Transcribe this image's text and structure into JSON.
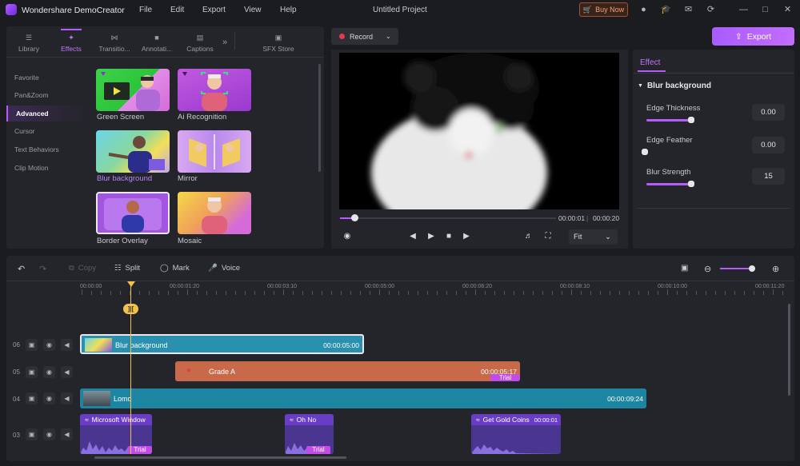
{
  "app": {
    "name": "Wondershare DemoCreator",
    "menu": [
      "File",
      "Edit",
      "Export",
      "View",
      "Help"
    ],
    "project_title": "Untitled Project",
    "buy_now": "Buy Now"
  },
  "library": {
    "tabs": [
      {
        "label": "Library",
        "icon": "layers-icon"
      },
      {
        "label": "Effects",
        "icon": "sparkle-icon",
        "active": true
      },
      {
        "label": "Transitio...",
        "icon": "bowtie-icon"
      },
      {
        "label": "Annotati...",
        "icon": "speech-bubble-icon"
      },
      {
        "label": "Captions",
        "icon": "captions-icon"
      }
    ],
    "sfx_store": "SFX Store",
    "categories": [
      "Favorite",
      "Pan&Zoom",
      "Advanced",
      "Cursor",
      "Text Behaviors",
      "Clip Motion"
    ],
    "active_category": "Advanced",
    "effects": [
      {
        "label": "Green Screen"
      },
      {
        "label": "Ai Recognition"
      },
      {
        "label": "Blur background"
      },
      {
        "label": "Mirror"
      },
      {
        "label": "Border Overlay"
      },
      {
        "label": "Mosaic"
      }
    ]
  },
  "preview": {
    "record": "Record",
    "time_current": "00:00:01",
    "time_sep": "|",
    "time_total": "00:00:20",
    "fit": "Fit",
    "progress": 0.05
  },
  "export": "Export",
  "effect_panel": {
    "tab": "Effect",
    "section": "Blur background",
    "params": [
      {
        "label": "Edge Thickness",
        "value": "0.00",
        "level": 0.97
      },
      {
        "label": "Edge Feather",
        "value": "0.00",
        "level": 0.0
      },
      {
        "label": "Blur Strength",
        "value": "15",
        "level": 0.97
      }
    ]
  },
  "timeline": {
    "tools": {
      "copy": "Copy",
      "split": "Split",
      "mark": "Mark",
      "voice": "Voice"
    },
    "ruler": [
      "00:00:00",
      "00:00:01:20",
      "00:00:03:10",
      "00:00:05:00",
      "00:00:06:20",
      "00:00:08:10",
      "00:00:10:00",
      "00:00:11:20"
    ],
    "tracks": [
      "06",
      "05",
      "04",
      "03"
    ],
    "clips": {
      "blur": {
        "label": "Blur background",
        "time": "00:00:05:00"
      },
      "grade": {
        "label": "Grade A",
        "time": "00:00:05:17",
        "trial": "Trial"
      },
      "lomo": {
        "label": "Lomo",
        "time": "00:00:09:24"
      },
      "audio1": {
        "label": "Microsoft Window",
        "trial": "Trial"
      },
      "audio2": {
        "label": "Oh No",
        "trial": "Trial"
      },
      "audio3": {
        "label": "Get Gold Coins",
        "time": "00:00:01"
      }
    },
    "playhead_marker": "]|["
  },
  "colors": {
    "accent": "#b55cff",
    "playhead": "#f2c24a",
    "video_clip": "#1f8aa6",
    "effect_clip": "#c8694a",
    "audio_clip": "#5a3fa8"
  }
}
